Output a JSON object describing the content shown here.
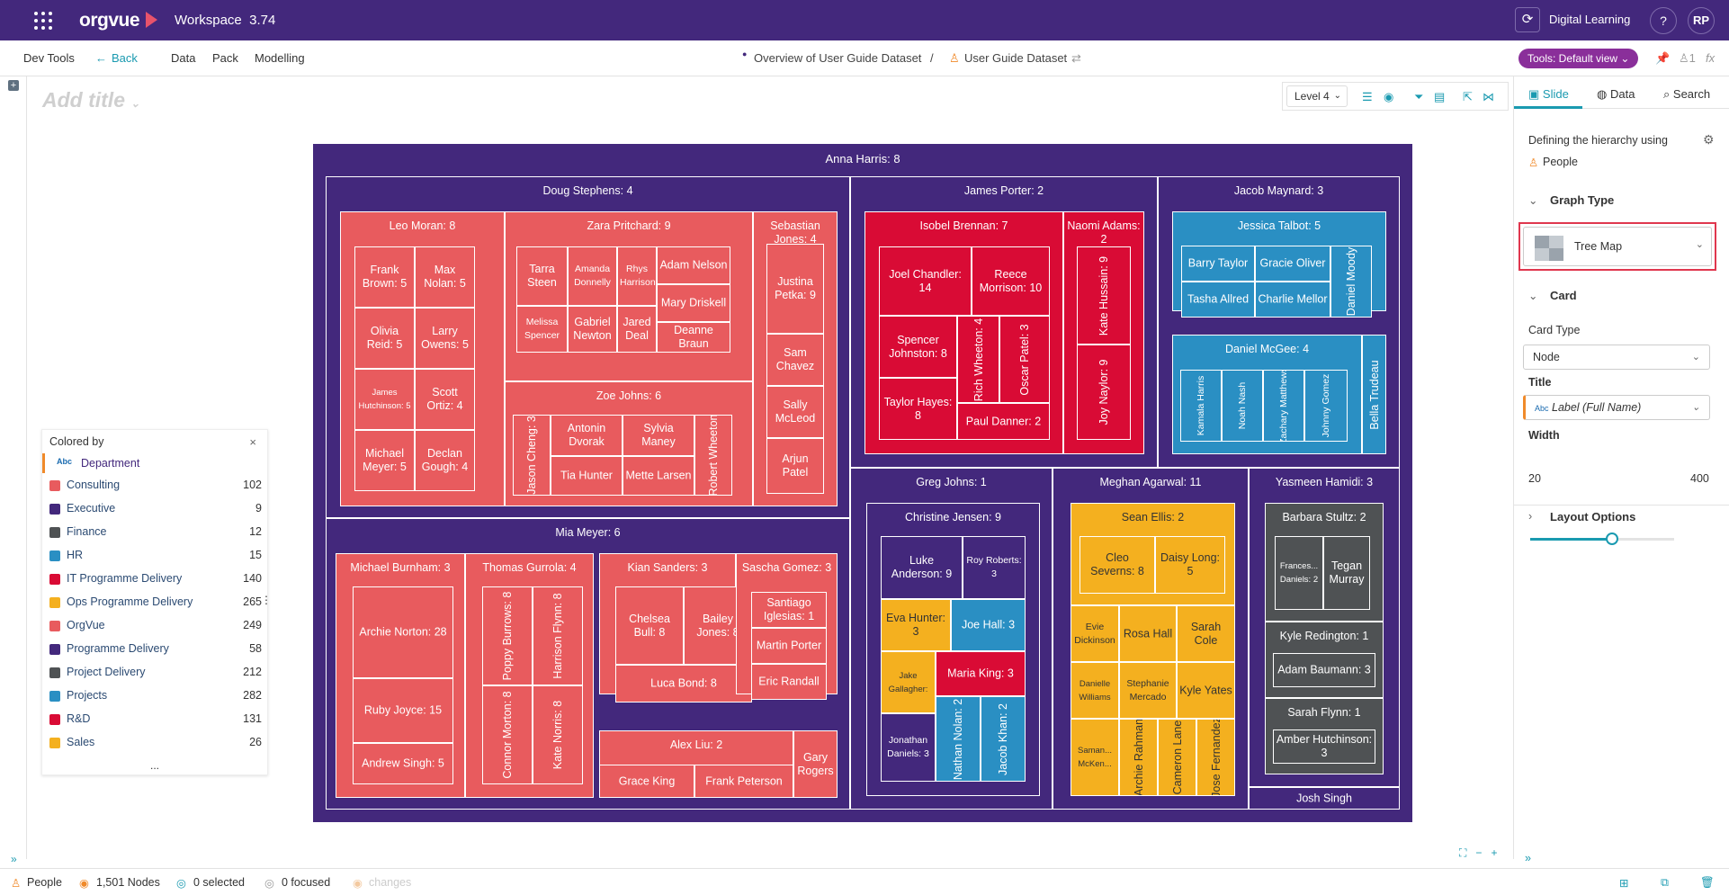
{
  "topbar": {
    "app": "orgvue",
    "workspace": "Workspace",
    "version": "3.74",
    "user_label": "Digital Learning",
    "help": "?",
    "avatar": "RP"
  },
  "subbar": {
    "dev_tools": "Dev Tools",
    "back": "Back",
    "data": "Data",
    "pack": "Pack",
    "modelling": "Modelling",
    "crumb1": "Overview of User Guide Dataset",
    "sep": "/",
    "crumb2": "User Guide Dataset",
    "tools": "Tools: Default view",
    "count": "1"
  },
  "canvas": {
    "add_title": "Add title",
    "level": "Level 4"
  },
  "right_panel": {
    "tabs": [
      "Slide",
      "Data",
      "Search"
    ],
    "defining": "Defining the hierarchy using",
    "people": "People",
    "graph_type_head": "Graph Type",
    "graph_type": "Tree Map",
    "card_head": "Card",
    "card_type_label": "Card Type",
    "card_type": "Node",
    "title_label": "Title",
    "title_value": "Label (Full Name)",
    "width_label": "Width",
    "width_min": "20",
    "width_max": "400",
    "layout_options": "Layout Options",
    "width_value_fraction": 0.57
  },
  "legend": {
    "title": "Colored by",
    "field": "Department",
    "more": "...",
    "items": [
      {
        "name": "Consulting",
        "count": "102",
        "color": "#e85b5e"
      },
      {
        "name": "Executive",
        "count": "9",
        "color": "#43287c"
      },
      {
        "name": "Finance",
        "count": "12",
        "color": "#4f5254"
      },
      {
        "name": "HR",
        "count": "15",
        "color": "#2a8fc3"
      },
      {
        "name": "IT Programme Delivery",
        "count": "140",
        "color": "#d90b35"
      },
      {
        "name": "Ops Programme Delivery",
        "count": "265",
        "color": "#f4b01f"
      },
      {
        "name": "OrgVue",
        "count": "249",
        "color": "#e85b5e"
      },
      {
        "name": "Programme Delivery",
        "count": "58",
        "color": "#43287c"
      },
      {
        "name": "Project Delivery",
        "count": "212",
        "color": "#4f5254"
      },
      {
        "name": "Projects",
        "count": "282",
        "color": "#2a8fc3"
      },
      {
        "name": "R&D",
        "count": "131",
        "color": "#d90b35"
      },
      {
        "name": "Sales",
        "count": "26",
        "color": "#f4b01f"
      }
    ]
  },
  "bottombar": {
    "people": "People",
    "nodes": "1,501 Nodes",
    "selected": "0 selected",
    "focused": "0 focused",
    "changes": "changes"
  },
  "treemap": {
    "root": "Anna Harris: 8",
    "doug": "Doug Stephens: 4",
    "leo": "Leo Moran: 8",
    "frank": "Frank Brown: 5",
    "max": "Max Nolan: 5",
    "olivia": "Olivia Reid: 5",
    "larry": "Larry Owens: 5",
    "james_h": "James Hutchinson: 5",
    "scott": "Scott Ortiz: 4",
    "michael_m": "Michael Meyer: 5",
    "declan": "Declan Gough: 4",
    "zara": "Zara Pritchard: 9",
    "tarra": "Tarra Steen",
    "amanda": "Amanda Donnelly",
    "rhys": "Rhys Harrison",
    "adam_n": "Adam Nelson",
    "mary": "Mary Driskell",
    "melissa": "Melissa Spencer",
    "gabriel": "Gabriel Newton",
    "jared": "Jared Deal",
    "deanne": "Deanne Braun",
    "zoe": "Zoe Johns: 6",
    "jason": "Jason Cheng: 3",
    "antonin": "Antonin Dvorak",
    "sylvia": "Sylvia Maney",
    "robert": "Robert Wheeton",
    "tia": "Tia Hunter",
    "mette": "Mette Larsen",
    "sebastian": "Sebastian Jones: 4",
    "justina": "Justina Petka: 9",
    "sam": "Sam Chavez",
    "sally": "Sally McLeod",
    "arjun": "Arjun Patel",
    "james_p": "James Porter: 2",
    "isobel": "Isobel Brennan: 7",
    "joel": "Joel Chandler: 14",
    "reece": "Reece Morrison: 10",
    "spencer": "Spencer Johnston: 8",
    "rich": "Rich Wheeton: 4",
    "oscar": "Oscar Patel: 3",
    "taylor": "Taylor Hayes: 8",
    "paul": "Paul Danner: 2",
    "naomi": "Naomi Adams: 2",
    "kate_h": "Kate Hussain: 9",
    "joy": "Joy Naylor: 9",
    "jacob": "Jacob Maynard: 3",
    "jessica": "Jessica Talbot: 5",
    "barry": "Barry Taylor",
    "gracie": "Gracie Oliver",
    "daniel_m": "Daniel Moody",
    "tasha": "Tasha Allred",
    "charlie": "Charlie Mellor",
    "daniel_mc": "Daniel McGee: 4",
    "kamala": "Kamala Harris",
    "noah": "Noah Nash",
    "zachary": "Zachary Matthews",
    "johnny": "Johnny Gomez",
    "bella": "Bella Trudeau",
    "mia": "Mia Meyer: 6",
    "michael_b": "Michael Burnham: 3",
    "archie_n": "Archie Norton: 28",
    "ruby": "Ruby Joyce: 15",
    "andrew": "Andrew Singh: 5",
    "thomas": "Thomas Gurrola: 4",
    "poppy": "Poppy Burrows: 8",
    "harrison": "Harrison Flynn: 8",
    "connor": "Connor Morton: 8",
    "kate_n": "Kate Norris: 8",
    "kian": "Kian Sanders: 3",
    "chelsea": "Chelsea Bull: 8",
    "bailey": "Bailey Jones: 8",
    "luca": "Luca Bond: 8",
    "sascha": "Sascha Gomez: 3",
    "santiago": "Santiago Iglesias: 1",
    "martin": "Martin Porter",
    "eric": "Eric Randall",
    "alex": "Alex Liu: 2",
    "grace": "Grace King",
    "frank_p": "Frank Peterson",
    "gary": "Gary Rogers",
    "greg": "Greg Johns: 1",
    "christine": "Christine Jensen: 9",
    "luke": "Luke Anderson: 9",
    "roy": "Roy Roberts: 3",
    "eva": "Eva Hunter: 3",
    "joe": "Joe Hall: 3",
    "jake": "Jake Gallagher:",
    "maria": "Maria King: 3",
    "jonathan": "Jonathan Daniels: 3",
    "nathan": "Nathan Nolan: 2",
    "jacob_k": "Jacob Khan: 2",
    "meghan": "Meghan Agarwal: 11",
    "sean": "Sean Ellis: 2",
    "cleo": "Cleo Severns: 8",
    "daisy": "Daisy Long: 5",
    "evie": "Evie Dickinson",
    "rosa": "Rosa Hall",
    "sarah_c": "Sarah Cole",
    "danielle": "Danielle Williams",
    "stephanie": "Stephanie Mercado",
    "kyle_y": "Kyle Yates",
    "saman": "Saman... McKen...",
    "archie_r": "Archie Rahman",
    "cameron": "Cameron Lane",
    "jose": "Jose Fernandez",
    "yasmeen": "Yasmeen Hamidi: 3",
    "barbara": "Barbara Stultz: 2",
    "frances": "Frances... Daniels: 2",
    "tegan": "Tegan Murray",
    "kyle_r": "Kyle Redington: 1",
    "adam_b": "Adam Baumann: 3",
    "sarah_f": "Sarah Flynn: 1",
    "amber": "Amber Hutchinson: 3",
    "josh": "Josh Singh"
  }
}
